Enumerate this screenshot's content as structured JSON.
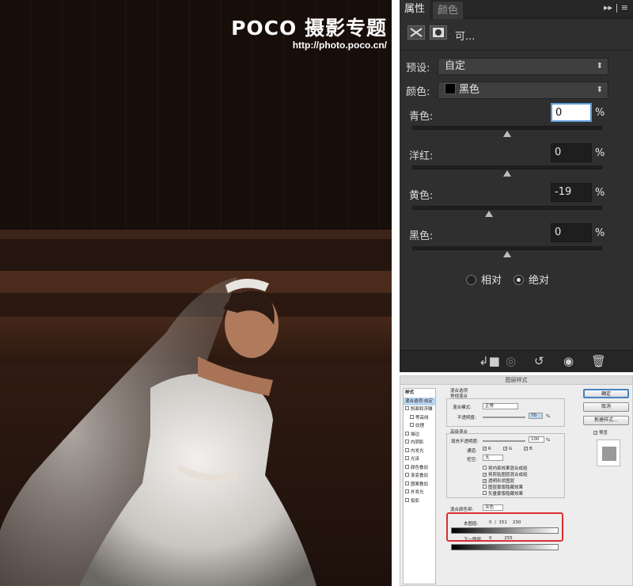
{
  "watermark": {
    "brand": "POCO 摄影专题",
    "url": "http://photo.poco.cn/"
  },
  "properties_panel": {
    "tabs": [
      "属性",
      "颜色"
    ],
    "menu_glyphs": "▸▸ | ≡",
    "adjustment_label": "可...",
    "preset": {
      "label": "预设:",
      "value": "自定"
    },
    "color": {
      "label": "颜色:",
      "value": "黑色"
    },
    "sliders": [
      {
        "label": "青色:",
        "value": "0",
        "percent": 0
      },
      {
        "label": "洋红:",
        "value": "0",
        "percent": 0
      },
      {
        "label": "黄色:",
        "value": "-19",
        "percent": -19
      },
      {
        "label": "黑色:",
        "value": "0",
        "percent": 0
      }
    ],
    "pct_sign": "%",
    "method": {
      "relative": "相对",
      "absolute": "绝对",
      "selected": "absolute"
    }
  },
  "layer_style_dialog": {
    "title": "图层样式",
    "styles_header": "样式",
    "style_items": [
      "混合选项:自定",
      "斜面和浮雕",
      "等高线",
      "纹理",
      "描边",
      "内阴影",
      "内发光",
      "光泽",
      "颜色叠加",
      "渐变叠加",
      "图案叠加",
      "外发光",
      "投影"
    ],
    "general_blending": "混合选项\n常规混合",
    "blend_mode_label": "混合模式:",
    "blend_mode_value": "正常",
    "opacity_label": "不透明度:",
    "opacity_value": "70",
    "advanced_blending": "高级混合",
    "fill_opacity_label": "填充不透明度:",
    "fill_opacity_value": "100",
    "channels_label": "通道:",
    "channels": [
      "R",
      "G",
      "B"
    ],
    "knockout_label": "挖空:",
    "knockout_value": "无",
    "options": [
      "将内部效果混合成组",
      "将剪贴图层混合成组",
      "透明形状图层",
      "图层蒙版隐藏效果",
      "矢量蒙版隐藏效果"
    ],
    "options_checked": [
      false,
      true,
      true,
      false,
      false
    ],
    "blend_if_label": "混合颜色带:",
    "blend_if_value": "灰色",
    "this_layer_label": "本图层:",
    "this_layer_values": "0  /  151    230",
    "underlying_label": "下一图层:",
    "underlying_values": "0         255",
    "buttons": [
      "确定",
      "取消",
      "新建样式...",
      "预览"
    ]
  },
  "colors": {
    "panel_bg": "#2f2f2f",
    "dialog_bg": "#ededed",
    "highlight": "#d93030"
  }
}
